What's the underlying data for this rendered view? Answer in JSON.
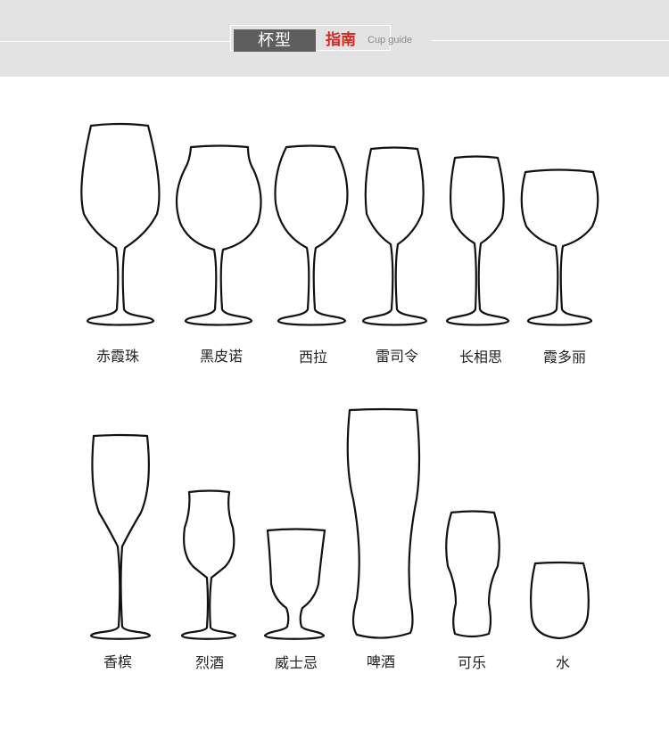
{
  "header": {
    "title_cn": "杯型",
    "title_red": "指南",
    "title_en": "Cup guide",
    "accent_color": "#d3281f"
  },
  "glasses": [
    {
      "label": "赤霞珠",
      "icon": "cabernet-glass-icon"
    },
    {
      "label": "黑皮诺",
      "icon": "pinot-noir-glass-icon"
    },
    {
      "label": "西拉",
      "icon": "syrah-glass-icon"
    },
    {
      "label": "雷司令",
      "icon": "riesling-glass-icon"
    },
    {
      "label": "长相思",
      "icon": "sauvignon-glass-icon"
    },
    {
      "label": "霞多丽",
      "icon": "chardonnay-glass-icon"
    },
    {
      "label": "香槟",
      "icon": "champagne-glass-icon"
    },
    {
      "label": "烈酒",
      "icon": "spirits-glass-icon"
    },
    {
      "label": "威士忌",
      "icon": "whisky-glass-icon"
    },
    {
      "label": "啤酒",
      "icon": "beer-glass-icon"
    },
    {
      "label": "可乐",
      "icon": "cola-glass-icon"
    },
    {
      "label": "水",
      "icon": "water-glass-icon"
    }
  ]
}
